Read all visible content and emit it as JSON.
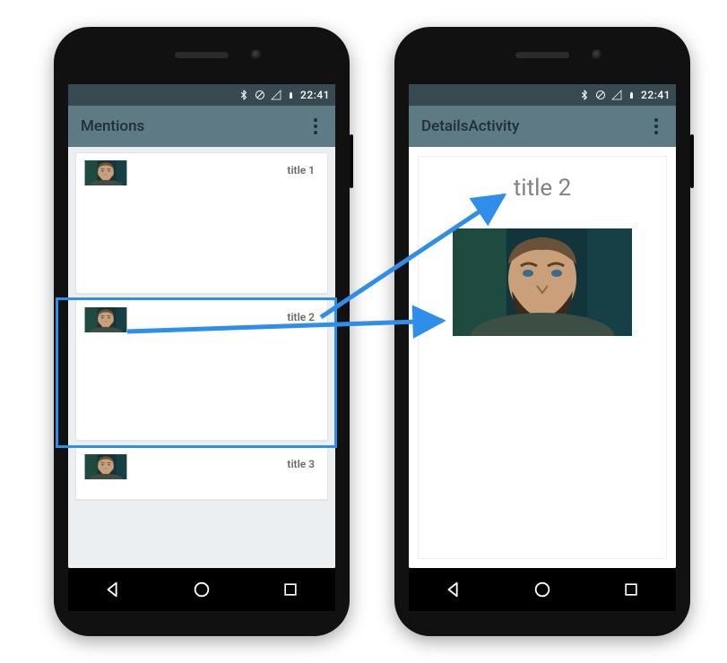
{
  "status": {
    "time": "22:41",
    "icons": [
      "bluetooth-icon",
      "do-not-disturb-icon",
      "signal-icon",
      "battery-icon"
    ]
  },
  "leftScreen": {
    "appTitle": "Mentions",
    "items": [
      {
        "title": "title 1"
      },
      {
        "title": "title 2"
      },
      {
        "title": "title 3"
      }
    ],
    "selectedIndex": 1
  },
  "rightScreen": {
    "appTitle": "DetailsActivity",
    "detailTitle": "title 2"
  },
  "arrowColor": "#2f8eea"
}
